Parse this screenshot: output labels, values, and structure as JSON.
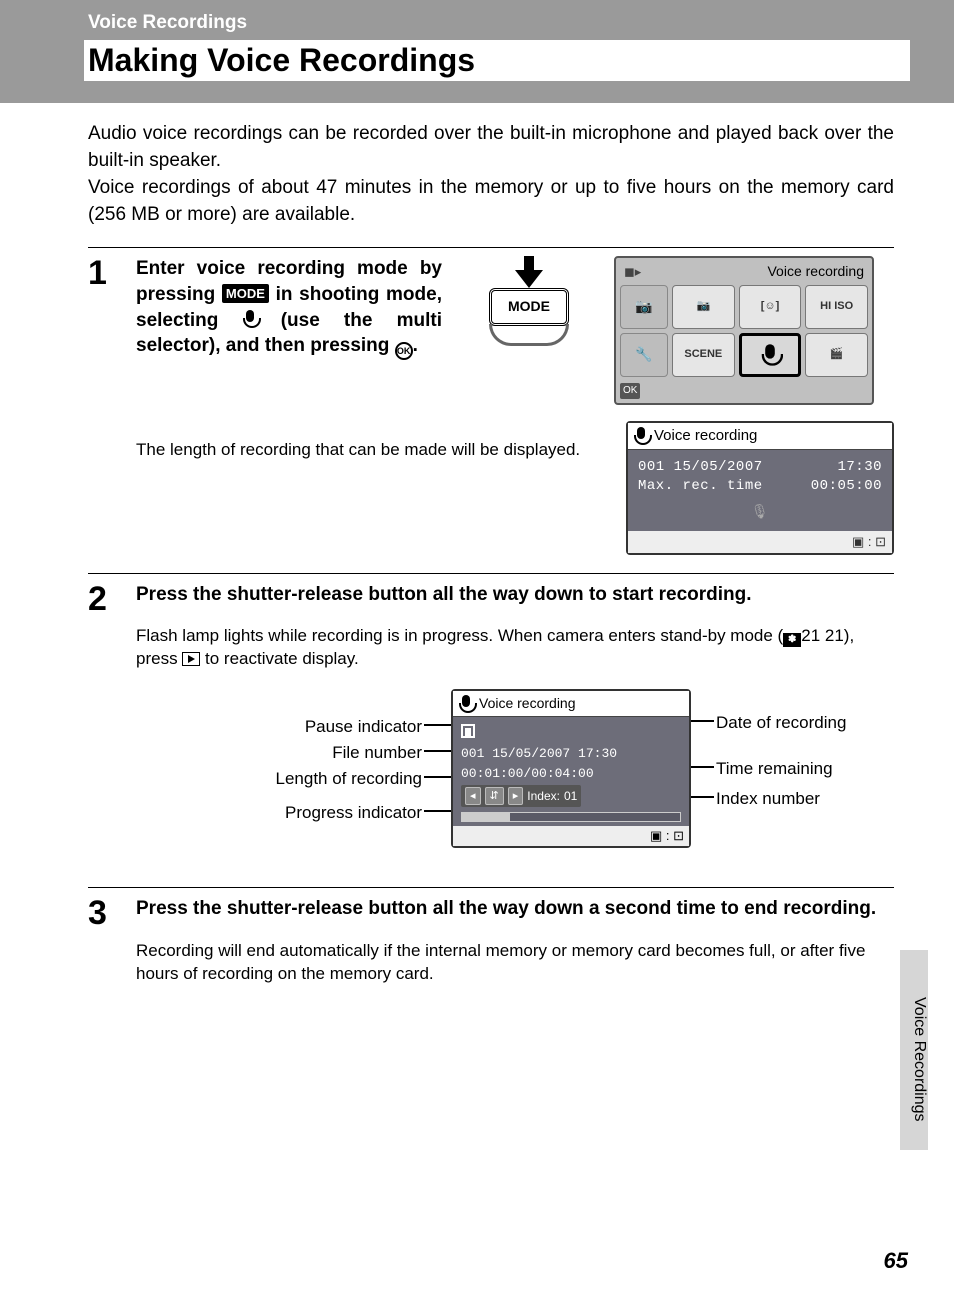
{
  "header": {
    "breadcrumb": "Voice Recordings",
    "title": "Making Voice Recordings"
  },
  "intro": {
    "p1": "Audio voice recordings can be recorded over the built-in microphone and played back over the built-in speaker.",
    "p2": "Voice recordings of about 47 minutes in the memory or up to five hours on the memory card (256 MB or more) are available."
  },
  "icons": {
    "mode": "MODE",
    "ok": "OK",
    "ref21": "21"
  },
  "step1": {
    "num": "1",
    "head_a": "Enter voice recording mode by pressing ",
    "head_b": " in shooting mode, selecting ",
    "head_c": " (use the multi selector), and then pressing ",
    "head_d": ".",
    "note": "The length of recording that can be made will be displayed."
  },
  "menu": {
    "title": "Voice recording",
    "cells": {
      "scene": "SCENE",
      "hi_iso": "HI ISO",
      "ok": "OK"
    }
  },
  "lcd1": {
    "title": "Voice recording",
    "file_no": "001",
    "date": "15/05/2007",
    "time": "17:30",
    "max_label": "Max. rec. time",
    "max_time": "00:05:00"
  },
  "step2": {
    "num": "2",
    "head": "Press the shutter-release button all the way down to start recording.",
    "body_a": "Flash lamp lights while recording is in progress. When camera enters stand-by mode (",
    "body_b": " 21), press ",
    "body_c": " to reactivate display."
  },
  "lcd2": {
    "title": "Voice recording",
    "file_no": "001",
    "date": "15/05/2007",
    "time": "17:30",
    "elapsed": "00:01:00/00:04:00",
    "index_label": "Index:",
    "index_val": "01"
  },
  "diag_labels": {
    "pause": "Pause indicator",
    "file": "File number",
    "length": "Length of recording",
    "progress": "Progress indicator",
    "date": "Date of recording",
    "remain": "Time remaining",
    "index": "Index number"
  },
  "step3": {
    "num": "3",
    "head": "Press the shutter-release button all the way down a second time to end recording.",
    "body": "Recording will end automatically if the internal memory or memory card becomes full, or after five hours of recording on the memory card."
  },
  "side_tab": "Voice Recordings",
  "page_num": "65"
}
